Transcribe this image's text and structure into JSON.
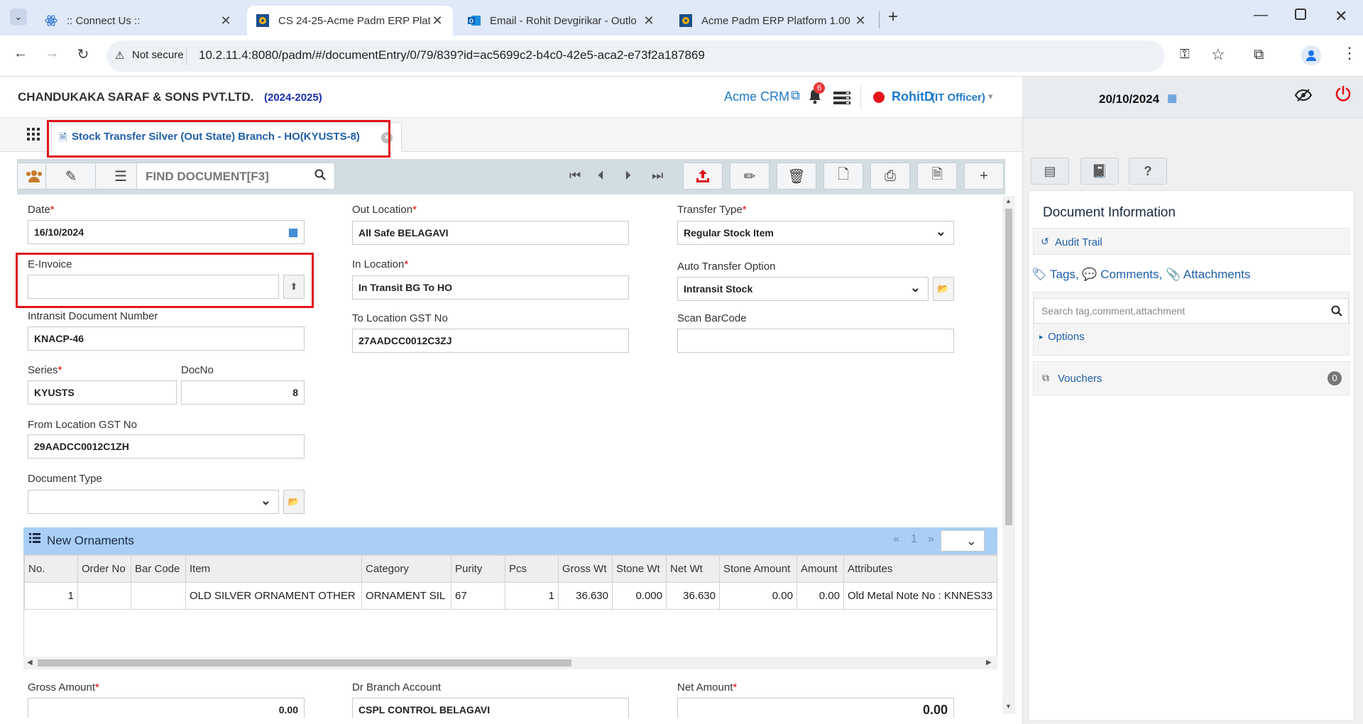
{
  "browser": {
    "tabs": [
      {
        "title": ":: Connect Us ::"
      },
      {
        "title": "CS 24-25-Acme Padm ERP Platf"
      },
      {
        "title": "Email - Rohit Devgirikar - Outlo"
      },
      {
        "title": "Acme Padm ERP Platform 1.00"
      }
    ],
    "security_label": "Not secure",
    "url": "10.2.11.4:8080/padm/#/documentEntry/0/79/839?id=ac5699c2-b4c0-42e5-aca2-e73f2a187869"
  },
  "header": {
    "company": "CHANDUKAKA SARAF & SONS PVT.LTD.",
    "year": "(2024-2025)",
    "crm_link": "Acme CRM",
    "notif_count": "6",
    "user": "RohitD",
    "role": "(IT Officer)",
    "date": "20/10/2024"
  },
  "doc_tab": {
    "title": "Stock Transfer Silver (Out State) Branch - HO(KYUSTS-8)"
  },
  "toolbar": {
    "search_placeholder": "FIND DOCUMENT[F3]"
  },
  "form": {
    "date_label": "Date",
    "date_value": "16/10/2024",
    "einvoice_label": "E-Invoice",
    "einvoice_value": "",
    "intransit_label": "Intransit Document Number",
    "intransit_value": "KNACP-46",
    "series_label": "Series",
    "series_value": "KYUSTS",
    "docno_label": "DocNo",
    "docno_value": "8",
    "from_gst_label": "From Location GST No",
    "from_gst_value": "29AADCC0012C1ZH",
    "doctype_label": "Document Type",
    "doctype_value": "",
    "out_location_label": "Out Location",
    "out_location_value": "All Safe BELAGAVI",
    "in_location_label": "In Location",
    "in_location_value": "In Transit BG To HO",
    "to_gst_label": "To Location GST No",
    "to_gst_value": "27AADCC0012C3ZJ",
    "transfer_type_label": "Transfer Type",
    "transfer_type_value": "Regular Stock Item",
    "auto_transfer_label": "Auto Transfer Option",
    "auto_transfer_value": "Intransit Stock",
    "scan_label": "Scan BarCode",
    "scan_value": ""
  },
  "grid": {
    "title": "New Ornaments",
    "prev": "«",
    "page": "1",
    "next": "»",
    "columns": [
      "No.",
      "Order No",
      "Bar Code",
      "Item",
      "Category",
      "Purity",
      "Pcs",
      "Gross Wt",
      "Stone Wt",
      "Net Wt",
      "Stone Amount",
      "Amount",
      "Attributes"
    ],
    "rows": [
      [
        "1",
        "",
        "",
        "OLD SILVER ORNAMENT OTHER",
        "ORNAMENT SIL",
        "67",
        "1",
        "36.630",
        "0.000",
        "36.630",
        "0.00",
        "0.00",
        "Old Metal Note No : KNNES33"
      ]
    ]
  },
  "footer": {
    "gross_label": "Gross Amount",
    "gross_value": "0.00",
    "dr_branch_label": "Dr Branch Account",
    "dr_branch_value": "CSPL CONTROL BELAGAVI",
    "net_label": "Net Amount",
    "net_value": "0.00"
  },
  "side": {
    "title": "Document Information",
    "audit": "Audit Trail",
    "tags": "Tags,",
    "comments": "Comments,",
    "attachments": "Attachments",
    "search_placeholder": "Search tag,comment,attachment",
    "options": "Options",
    "vouchers": "Vouchers",
    "vouchers_count": "0"
  },
  "colors": {
    "accent": "#1f5fa8",
    "grid_header": "#a9cff6",
    "highlight": "#e0151b",
    "power": "#e0151b"
  }
}
